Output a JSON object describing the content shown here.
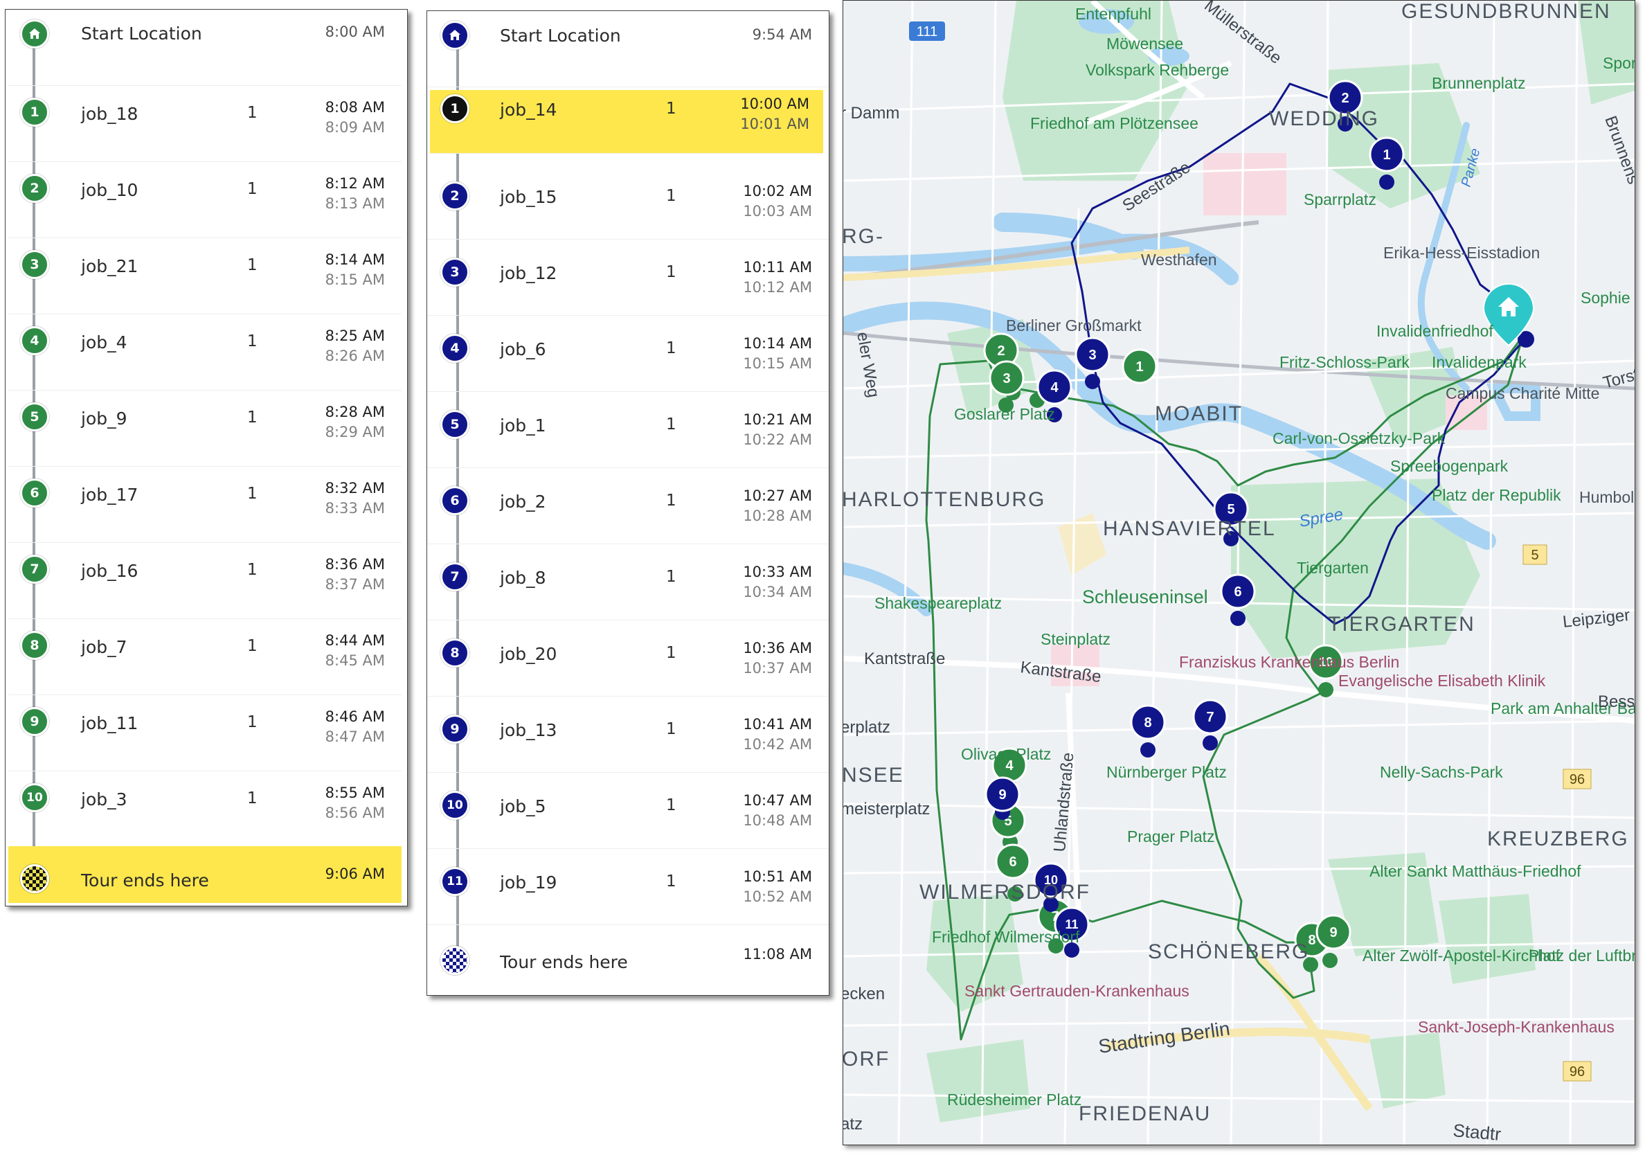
{
  "tour_a": {
    "color": "#2e8b45",
    "start": {
      "label": "Start Location",
      "time": "8:00 AM",
      "icon": "home-icon"
    },
    "stops": [
      {
        "n": "1",
        "job": "job_18",
        "qty": "1",
        "arrive": "8:08 AM",
        "depart": "8:09 AM"
      },
      {
        "n": "2",
        "job": "job_10",
        "qty": "1",
        "arrive": "8:12 AM",
        "depart": "8:13 AM"
      },
      {
        "n": "3",
        "job": "job_21",
        "qty": "1",
        "arrive": "8:14 AM",
        "depart": "8:15 AM"
      },
      {
        "n": "4",
        "job": "job_4",
        "qty": "1",
        "arrive": "8:25 AM",
        "depart": "8:26 AM"
      },
      {
        "n": "5",
        "job": "job_9",
        "qty": "1",
        "arrive": "8:28 AM",
        "depart": "8:29 AM"
      },
      {
        "n": "6",
        "job": "job_17",
        "qty": "1",
        "arrive": "8:32 AM",
        "depart": "8:33 AM"
      },
      {
        "n": "7",
        "job": "job_16",
        "qty": "1",
        "arrive": "8:36 AM",
        "depart": "8:37 AM"
      },
      {
        "n": "8",
        "job": "job_7",
        "qty": "1",
        "arrive": "8:44 AM",
        "depart": "8:45 AM"
      },
      {
        "n": "9",
        "job": "job_11",
        "qty": "1",
        "arrive": "8:46 AM",
        "depart": "8:47 AM"
      },
      {
        "n": "10",
        "job": "job_3",
        "qty": "1",
        "arrive": "8:55 AM",
        "depart": "8:56 AM"
      }
    ],
    "end": {
      "label": "Tour ends here",
      "time": "9:06 AM",
      "icon": "checkered-flag-icon"
    }
  },
  "tour_b": {
    "color": "#10168a",
    "start": {
      "label": "Start Location",
      "time": "9:54 AM",
      "icon": "home-icon"
    },
    "stops": [
      {
        "n": "1",
        "job": "job_14",
        "qty": "1",
        "arrive": "10:00 AM",
        "depart": "10:01 AM"
      },
      {
        "n": "2",
        "job": "job_15",
        "qty": "1",
        "arrive": "10:02 AM",
        "depart": "10:03 AM"
      },
      {
        "n": "3",
        "job": "job_12",
        "qty": "1",
        "arrive": "10:11 AM",
        "depart": "10:12 AM"
      },
      {
        "n": "4",
        "job": "job_6",
        "qty": "1",
        "arrive": "10:14 AM",
        "depart": "10:15 AM"
      },
      {
        "n": "5",
        "job": "job_1",
        "qty": "1",
        "arrive": "10:21 AM",
        "depart": "10:22 AM"
      },
      {
        "n": "6",
        "job": "job_2",
        "qty": "1",
        "arrive": "10:27 AM",
        "depart": "10:28 AM"
      },
      {
        "n": "7",
        "job": "job_8",
        "qty": "1",
        "arrive": "10:33 AM",
        "depart": "10:34 AM"
      },
      {
        "n": "8",
        "job": "job_20",
        "qty": "1",
        "arrive": "10:36 AM",
        "depart": "10:37 AM"
      },
      {
        "n": "9",
        "job": "job_13",
        "qty": "1",
        "arrive": "10:41 AM",
        "depart": "10:42 AM"
      },
      {
        "n": "10",
        "job": "job_5",
        "qty": "1",
        "arrive": "10:47 AM",
        "depart": "10:48 AM"
      },
      {
        "n": "11",
        "job": "job_19",
        "qty": "1",
        "arrive": "10:51 AM",
        "depart": "10:52 AM"
      }
    ],
    "end": {
      "label": "Tour ends here",
      "time": "11:08 AM",
      "icon": "checkered-flag-icon"
    }
  },
  "map": {
    "colors": {
      "water": "#a9d3f2",
      "park": "#c6e7cf",
      "road": "#ffffff",
      "major_road": "#f7e8b0",
      "land": "#eef1f4",
      "rail": "#b9bec6",
      "depot": "#2ec7c9"
    },
    "districts": [
      "GESUNDBRUNNEN",
      "WEDDING",
      "MOABIT",
      "HARLOTTENBURG",
      "HANSAVIERTEL",
      "TIERGARTEN",
      "KREUZBERG",
      "WILMERSDORF",
      "SCHÖNEBERG",
      "FRIEDENAU",
      "NSEE",
      "RG-",
      "ORF"
    ],
    "places": [
      "Entenpfuhl",
      "Möwensee",
      "Volkspark Rehberge",
      "Friedhof am Plötzensee",
      "Brunnenplatz",
      "Sparrplatz",
      "Westhafen",
      "Erika-Hess-Eisstadion",
      "Berliner Großmarkt",
      "Goslarer Platz",
      "Invalidenfriedhof",
      "Invalidenpark",
      "Campus Charité Mitte",
      "Fritz-Schloss-Park",
      "Carl-von-Ossietzky-Park",
      "Spreebogenpark",
      "Platz der Republik",
      "Schleuseninsel",
      "Shakespeareplatz",
      "Steinplatz",
      "Tiergarten",
      "Franziskus Krankenhaus Berlin",
      "Evangelische Elisabeth Klinik",
      "Park am Anhalter Bahnhof",
      "Nürnberger Platz",
      "Prager Platz",
      "Nelly-Sachs-Park",
      "Alter Sankt Matthäus-Friedhof",
      "Friedhof Wilmersdorf",
      "Alter Zwölf-Apostel-Kirchhof",
      "Platz der Luftbrücke",
      "Sankt Gertrauden-Krankenhaus",
      "Sankt-Joseph-Krankenhaus",
      "Rüdesheimer Platz",
      "Olivaer Platz",
      "Sophie Friedhof",
      "Humboldt Universität zu Berlin",
      "Sport Wed"
    ],
    "streets": [
      "Seestraße",
      "Müllerstraße",
      "Kantstraße",
      "Uhlandstraße",
      "Stadtring Berlin",
      "Leipziger Str",
      "Torst",
      "Besselp",
      "Brunnens",
      "r Damm",
      "eler Weg",
      "erplatz",
      "meisterplatz",
      "Spree",
      "Panke",
      "ecken",
      "atz",
      "Stadtr"
    ],
    "shields": [
      "111",
      "5",
      "96",
      "96"
    ]
  }
}
